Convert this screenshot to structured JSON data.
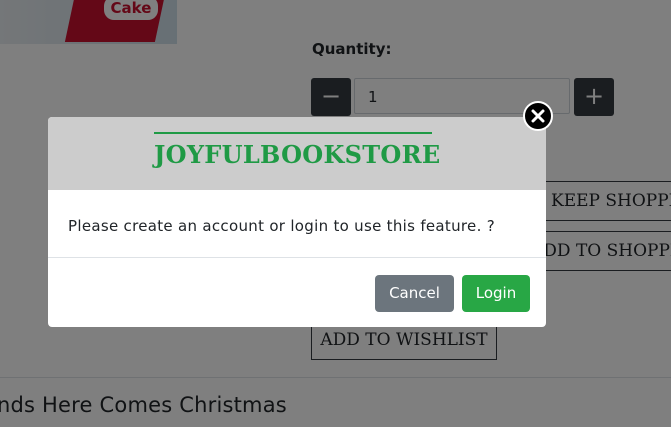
{
  "product": {
    "image_label": "Cake",
    "quantity_label": "Quantity:",
    "quantity_value": "1",
    "minus_symbol": "−",
    "plus_symbol": "+",
    "keep_shopping": "KEEP SHOPPING",
    "add_to_cart": "ADD TO SHOPPING CART",
    "add_to_wishlist": "ADD TO WISHLIST"
  },
  "related": {
    "title": "nds Here Comes Christmas"
  },
  "modal": {
    "brand": "JOYFULBOOKSTORE",
    "message": "Please create an account or login to use this feature. ?",
    "cancel_label": "Cancel",
    "login_label": "Login",
    "close_icon": "close-icon"
  },
  "colors": {
    "brand_green": "#1f9a45",
    "login_green": "#28a745",
    "cancel_gray": "#6c757d",
    "dark_button": "#343a40"
  }
}
